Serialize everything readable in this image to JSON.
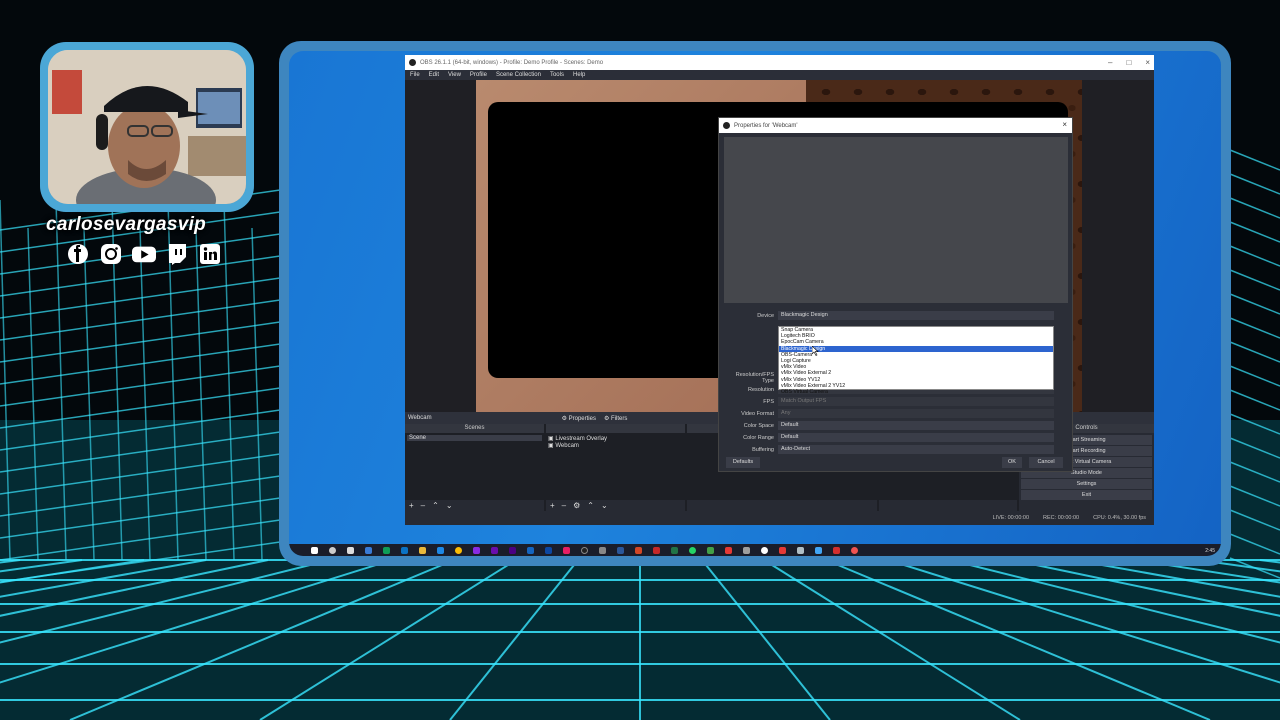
{
  "streamer": {
    "handle": "carlosevargasvip",
    "socials": [
      {
        "name": "facebook-icon"
      },
      {
        "name": "instagram-icon"
      },
      {
        "name": "youtube-icon"
      },
      {
        "name": "twitch-icon"
      },
      {
        "name": "linkedin-icon"
      }
    ]
  },
  "obs": {
    "title": "OBS 26.1.1 (64-bit, windows) - Profile: Demo Profile - Scenes: Demo",
    "menu": [
      "File",
      "Edit",
      "View",
      "Profile",
      "Scene Collection",
      "Tools",
      "Help"
    ],
    "source_bar": {
      "source": "Webcam",
      "properties": "Properties",
      "filters": "Filters"
    },
    "scenes": {
      "header": "Scenes",
      "items": [
        "Scene"
      ]
    },
    "sources": {
      "header": "Sources",
      "items": [
        "Livestream Overlay",
        "Webcam"
      ]
    },
    "transitions_header": "ons",
    "controls": {
      "header": "Controls",
      "buttons": [
        "Start Streaming",
        "Start Recording",
        "Start Virtual Camera",
        "Studio Mode",
        "Settings",
        "Exit"
      ]
    },
    "status": {
      "live": "LIVE: 00:00:00",
      "rec": "REC: 00:00:00",
      "cpu": "CPU: 0.4%, 30.00 fps"
    }
  },
  "dialog": {
    "title": "Properties for 'Webcam'",
    "fields": [
      {
        "label": "Device",
        "value": "Blackmagic Design"
      },
      {
        "label": "Resolution/FPS Type",
        "value": ""
      },
      {
        "label": "Resolution",
        "value": ""
      },
      {
        "label": "FPS",
        "value": "Match Output FPS"
      },
      {
        "label": "Video Format",
        "value": "Any"
      },
      {
        "label": "Color Space",
        "value": "Default"
      },
      {
        "label": "Color Range",
        "value": "Default"
      },
      {
        "label": "Buffering",
        "value": "Auto-Detect"
      }
    ],
    "dropdown_options": [
      "Snap Camera",
      "Logitech BRIO",
      "EpocCam Camera",
      "Blackmagic Design",
      "OBS-Camera",
      "Logi Capture",
      "vMix Video",
      "vMix Video External 2",
      "vMix Video YV12",
      "vMix Video External 2 YV12",
      "OBS Virtual Camera"
    ],
    "selected_option_index": 3,
    "buttons": {
      "defaults": "Defaults",
      "ok": "OK",
      "cancel": "Cancel"
    }
  },
  "taskbar": {
    "clock": "2:45"
  },
  "colors": {
    "frame": "#3e86bf",
    "desktop": "#1e83dd",
    "grid_neon": "#39e6ff",
    "highlight": "#2d64cf"
  }
}
